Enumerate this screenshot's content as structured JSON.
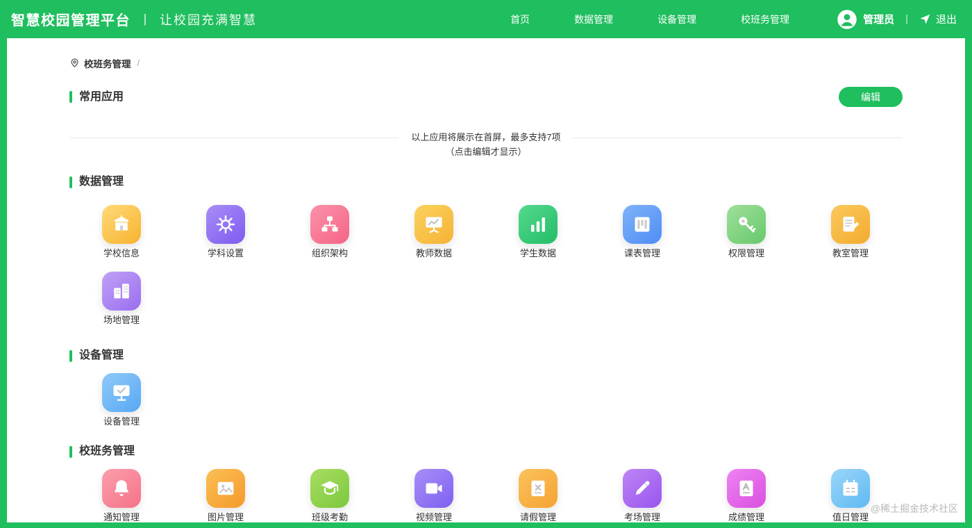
{
  "theme": {
    "primary_green": "#1fbe5e"
  },
  "header": {
    "brand": "智慧校园管理平台",
    "brand_separator": "丨",
    "slogan": "让校园充满智慧",
    "nav": [
      {
        "label": "首页"
      },
      {
        "label": "数据管理"
      },
      {
        "label": "设备管理"
      },
      {
        "label": "校班务管理"
      }
    ],
    "user": {
      "name": "管理员",
      "divider": "|",
      "logout": "退出"
    }
  },
  "breadcrumb": {
    "current": "校班务管理",
    "separator": "/"
  },
  "favorites": {
    "title": "常用应用",
    "edit_button": "编辑",
    "hint_line1": "以上应用将展示在首屏，最多支持7项",
    "hint_line2": "（点击编辑才显示）"
  },
  "sections": [
    {
      "title": "数据管理",
      "apps": [
        {
          "label": "学校信息",
          "icon": "school-building-icon",
          "color": "#f7b32e"
        },
        {
          "label": "学科设置",
          "icon": "gear-icon",
          "color": "#7d5bf0"
        },
        {
          "label": "组织架构",
          "icon": "org-chart-icon",
          "color": "#f56585"
        },
        {
          "label": "教师数据",
          "icon": "presentation-chart-icon",
          "color": "#f5b335"
        },
        {
          "label": "学生数据",
          "icon": "bar-chart-icon",
          "color": "#23bd68"
        },
        {
          "label": "课表管理",
          "icon": "timetable-icon",
          "color": "#4f8df5"
        },
        {
          "label": "权限管理",
          "icon": "key-icon",
          "color": "#67c96a"
        },
        {
          "label": "教室管理",
          "icon": "edit-document-icon",
          "color": "#f3ab2f"
        },
        {
          "label": "场地管理",
          "icon": "building-icon",
          "color": "#9a6ef0"
        }
      ]
    },
    {
      "title": "设备管理",
      "apps": [
        {
          "label": "设备管理",
          "icon": "monitor-check-icon",
          "color": "#58a8f4"
        }
      ]
    },
    {
      "title": "校班务管理",
      "apps": [
        {
          "label": "通知管理",
          "icon": "bell-icon",
          "color": "#f57287"
        },
        {
          "label": "图片管理",
          "icon": "image-icon",
          "color": "#f59a2b"
        },
        {
          "label": "班级考勤",
          "icon": "graduation-cap-icon",
          "color": "#7cc93d"
        },
        {
          "label": "视频管理",
          "icon": "video-camera-icon",
          "color": "#7e61f1"
        },
        {
          "label": "请假管理",
          "icon": "document-x-icon",
          "color": "#f5a332"
        },
        {
          "label": "考场管理",
          "icon": "pen-icon",
          "color": "#9a55ee"
        },
        {
          "label": "成绩管理",
          "icon": "grade-document-icon",
          "color": "#d94fe0"
        },
        {
          "label": "值日管理",
          "icon": "calendar-icon",
          "color": "#5fb9f2"
        }
      ]
    }
  ],
  "watermark": "@稀土掘金技术社区"
}
